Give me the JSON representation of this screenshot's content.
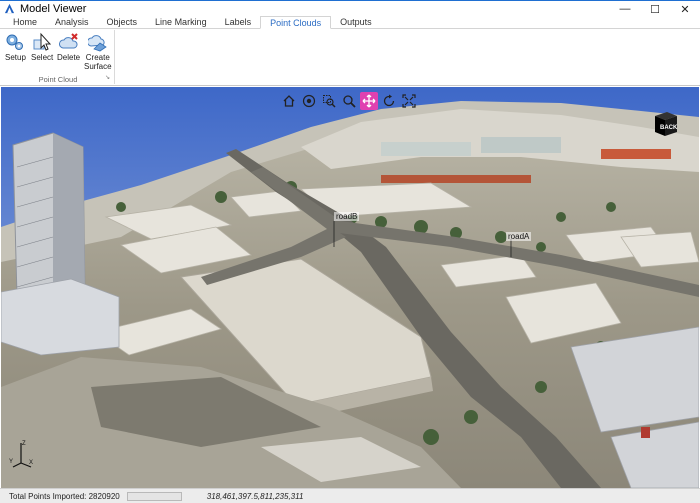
{
  "window": {
    "title": "Model Viewer",
    "controls": {
      "minimize": "—",
      "maximize": "☐",
      "close": "✕"
    }
  },
  "tabs": [
    {
      "label": "Home"
    },
    {
      "label": "Analysis"
    },
    {
      "label": "Objects"
    },
    {
      "label": "Line Marking"
    },
    {
      "label": "Labels"
    },
    {
      "label": "Point Clouds"
    },
    {
      "label": "Outputs"
    }
  ],
  "active_tab": "Point Clouds",
  "ribbon": {
    "group_label": "Point Cloud",
    "buttons": [
      {
        "label": "Setup",
        "icon": "setup-gears-icon"
      },
      {
        "label": "Select",
        "icon": "cursor-icon"
      },
      {
        "label": "Delete",
        "icon": "cloud-delete-icon"
      },
      {
        "label": "Create",
        "label2": "Surface",
        "icon": "create-surface-icon"
      }
    ]
  },
  "viewport": {
    "nav_tools": [
      {
        "icon": "home-icon"
      },
      {
        "icon": "eye-orbit-icon"
      },
      {
        "icon": "zoom-window-icon"
      },
      {
        "icon": "magnifier-icon"
      },
      {
        "icon": "pan-icon",
        "active": true
      },
      {
        "icon": "rotate-icon"
      },
      {
        "icon": "zoom-extents-icon"
      }
    ],
    "road_labels": [
      {
        "text": "roadB"
      },
      {
        "text": "roadA"
      }
    ],
    "viewcube_face": "BACK",
    "axes": {
      "z": "Z",
      "y": "Y",
      "x": "X"
    }
  },
  "status": {
    "points_label": "Total Points Imported: 2820920",
    "progress_fraction": 0,
    "coordinates": "318,461,397.5,811,235,311"
  },
  "colors": {
    "accent": "#2b6cc4",
    "active_tool": "#e041b0",
    "progress": "#06b025"
  }
}
